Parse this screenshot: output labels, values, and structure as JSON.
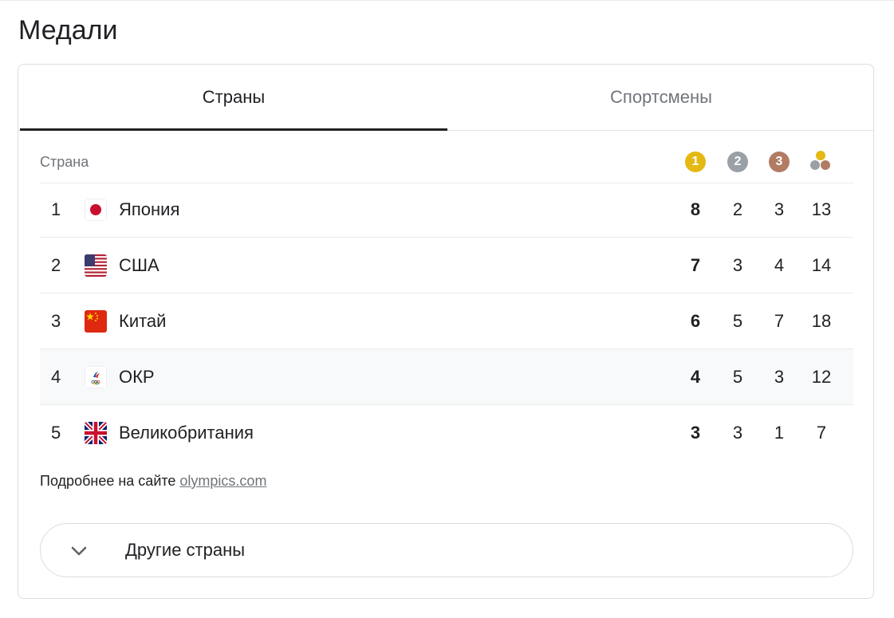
{
  "page": {
    "title": "Медали"
  },
  "tabs": [
    {
      "label": "Страны",
      "active": true
    },
    {
      "label": "Спортсмены",
      "active": false
    }
  ],
  "table": {
    "columns": {
      "country": "Страна",
      "gold": "1",
      "silver": "2",
      "bronze": "3",
      "total_icon": "medals-total-icon"
    },
    "colors": {
      "gold": "#e5b813",
      "silver": "#9aa0a6",
      "bronze": "#b27b63"
    },
    "rows": [
      {
        "rank": "1",
        "country": "Япония",
        "flag": "japan-flag-icon",
        "gold": "8",
        "silver": "2",
        "bronze": "3",
        "total": "13"
      },
      {
        "rank": "2",
        "country": "США",
        "flag": "usa-flag-icon",
        "gold": "7",
        "silver": "3",
        "bronze": "4",
        "total": "14"
      },
      {
        "rank": "3",
        "country": "Китай",
        "flag": "china-flag-icon",
        "gold": "6",
        "silver": "5",
        "bronze": "7",
        "total": "18"
      },
      {
        "rank": "4",
        "country": "ОКР",
        "flag": "roc-flag-icon",
        "gold": "4",
        "silver": "5",
        "bronze": "3",
        "total": "12"
      },
      {
        "rank": "5",
        "country": "Великобритания",
        "flag": "uk-flag-icon",
        "gold": "3",
        "silver": "3",
        "bronze": "1",
        "total": "7"
      }
    ]
  },
  "footer": {
    "more_prefix": "Подробнее на сайте ",
    "more_link": "olympics.com",
    "expand_label": "Другие страны",
    "expand_icon": "chevron-down-icon"
  }
}
